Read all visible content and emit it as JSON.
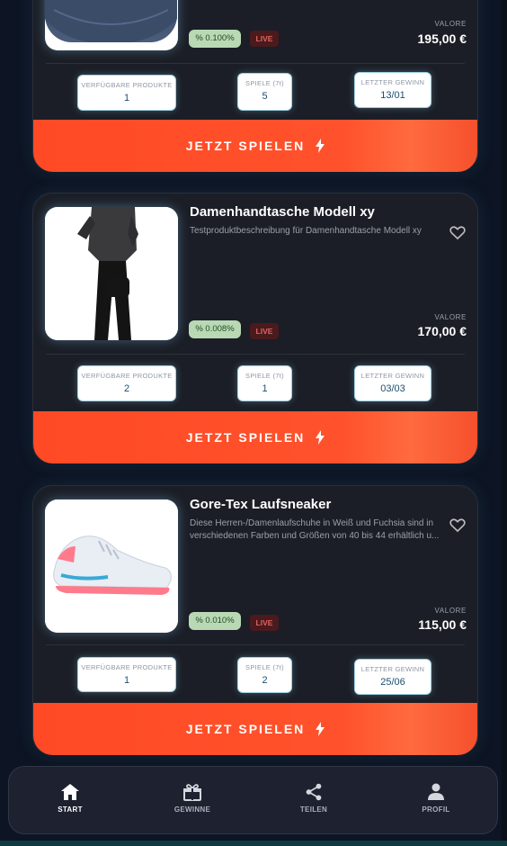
{
  "products": [
    {
      "title": "",
      "description": "",
      "percent": "% 0.100%",
      "status": "LIVE",
      "value_label": "VALORE",
      "price": "195,00 €",
      "stats": {
        "available_label": "VERFÜGBARE PRODUKTE",
        "available": "1",
        "games_label": "SPIELE (7t)",
        "games": "5",
        "last_win_label": "LETZTER GEWINN",
        "last_win": "13/01"
      },
      "cta": "JETZT SPIELEN"
    },
    {
      "title": "Damenhandtasche Modell xy",
      "description": "Testproduktbeschreibung für Damenhandtasche Modell xy",
      "percent": "% 0.008%",
      "status": "LIVE",
      "value_label": "VALORE",
      "price": "170,00 €",
      "stats": {
        "available_label": "VERFÜGBARE PRODUKTE",
        "available": "2",
        "games_label": "SPIELE (7t)",
        "games": "1",
        "last_win_label": "LETZTER GEWINN",
        "last_win": "03/03"
      },
      "cta": "JETZT SPIELEN"
    },
    {
      "title": "Gore-Tex Laufsneaker",
      "description": "Diese Herren-/Damenlaufschuhe in Weiß und Fuchsia sind in verschiedenen Farben und Größen von 40 bis 44 erhältlich u...",
      "percent": "% 0.010%",
      "status": "LIVE",
      "value_label": "VALORE",
      "price": "115,00 €",
      "stats": {
        "available_label": "VERFÜGBARE PRODUKTE",
        "available": "1",
        "games_label": "SPIELE (7t)",
        "games": "2",
        "last_win_label": "LETZTER GEWINN",
        "last_win": "25/06"
      },
      "cta": "JETZT SPIELEN"
    }
  ],
  "nav": {
    "items": [
      {
        "label": "START",
        "icon": "home-icon",
        "active": true
      },
      {
        "label": "GEWINNE",
        "icon": "gift-icon",
        "active": false
      },
      {
        "label": "TEILEN",
        "icon": "share-icon",
        "active": false
      },
      {
        "label": "PROFIL",
        "icon": "person-icon",
        "active": false
      }
    ]
  },
  "colors": {
    "background": "#0d1524",
    "card": "#1b1e26",
    "accent": "#ff4a25",
    "percent_bg": "#b9d9b4",
    "live_bg": "#4a1a1d",
    "live_text": "#e1645e"
  }
}
